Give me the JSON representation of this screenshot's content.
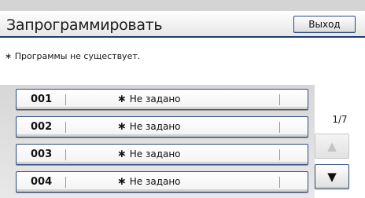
{
  "header": {
    "title": "Запрограммировать",
    "exit_label": "Выход"
  },
  "note": "∗ Программы не существует.",
  "programs": [
    {
      "number": "001",
      "label": "Не задано",
      "star": "∗"
    },
    {
      "number": "002",
      "label": "Не задано",
      "star": "∗"
    },
    {
      "number": "003",
      "label": "Не задано",
      "star": "∗"
    },
    {
      "number": "004",
      "label": "Не задано",
      "star": "∗"
    }
  ],
  "pagination": {
    "indicator": "1/7",
    "up_icon": "▲",
    "down_icon": "▼",
    "up_enabled": false
  },
  "colors": {
    "accent": "#2b4a80",
    "header_border": "#1d3b73"
  }
}
